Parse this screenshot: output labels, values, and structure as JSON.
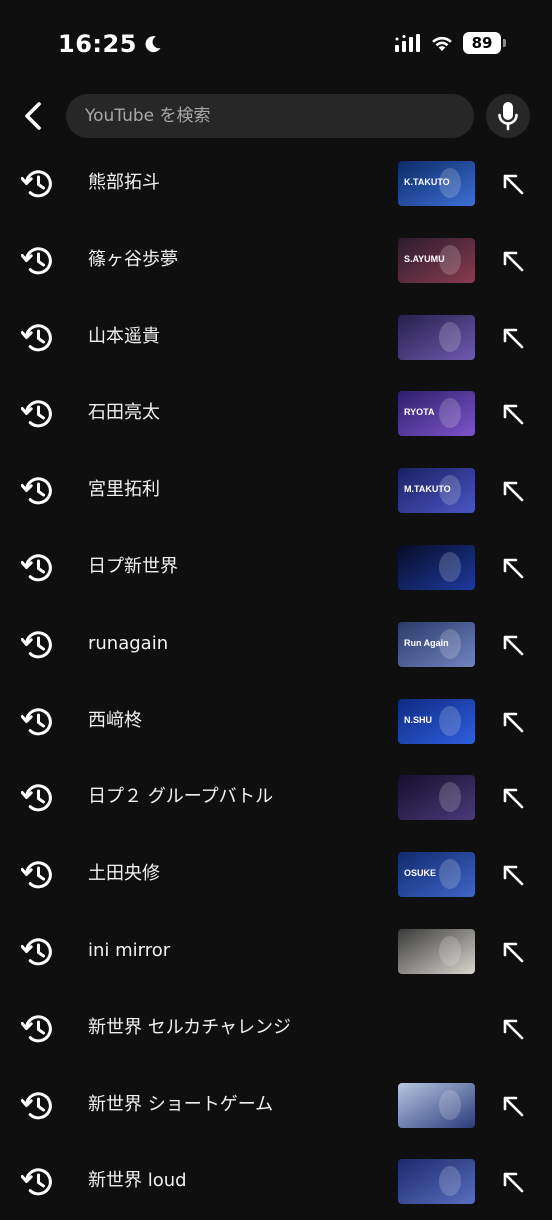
{
  "status_bar": {
    "time": "16:25",
    "battery": "89"
  },
  "header": {
    "search_placeholder": "YouTube を検索"
  },
  "history": [
    {
      "label": "熊部拓斗",
      "thumb": {
        "colors": [
          "#0d2a66",
          "#3d6fd6"
        ],
        "caption": "K.TAKUTO"
      }
    },
    {
      "label": "篠ヶ谷歩夢",
      "thumb": {
        "colors": [
          "#2a1c2c",
          "#8a3b50"
        ],
        "caption": "S.AYUMU"
      }
    },
    {
      "label": "山本遥貴",
      "thumb": {
        "colors": [
          "#26204a",
          "#6e5ab0"
        ],
        "caption": ""
      }
    },
    {
      "label": "石田亮太",
      "thumb": {
        "colors": [
          "#2c1f6b",
          "#7d55c9"
        ],
        "caption": "RYOTA"
      }
    },
    {
      "label": "宮里拓利",
      "thumb": {
        "colors": [
          "#1b2062",
          "#4b56c6"
        ],
        "caption": "M.TAKUTO"
      }
    },
    {
      "label": "日プ新世界",
      "thumb": {
        "colors": [
          "#070c25",
          "#1d3aa0"
        ],
        "caption": ""
      }
    },
    {
      "label": "runagain",
      "thumb": {
        "colors": [
          "#2b3a6a",
          "#7284c0"
        ],
        "caption": "Run Again"
      }
    },
    {
      "label": "西﨑柊",
      "thumb": {
        "colors": [
          "#0e2a80",
          "#2f5fe0"
        ],
        "caption": "N.SHU"
      }
    },
    {
      "label": "日プ２ グループバトル",
      "thumb": {
        "colors": [
          "#150f2c",
          "#4a3a7a"
        ],
        "caption": ""
      }
    },
    {
      "label": "土田央修",
      "thumb": {
        "colors": [
          "#112a6e",
          "#3e65c8"
        ],
        "caption": "OSUKE"
      }
    },
    {
      "label": "ini mirror",
      "thumb": {
        "colors": [
          "#3a3a3a",
          "#d9d6d0"
        ],
        "caption": ""
      }
    },
    {
      "label": "新世界 セルカチャレンジ",
      "thumb": null
    },
    {
      "label": "新世界 ショートゲーム",
      "thumb": {
        "colors": [
          "#b7c6e0",
          "#2a3b7a"
        ],
        "caption": ""
      }
    },
    {
      "label": "新世界 loud",
      "thumb": {
        "colors": [
          "#1b2a6a",
          "#5a6ec0"
        ],
        "caption": ""
      }
    }
  ]
}
